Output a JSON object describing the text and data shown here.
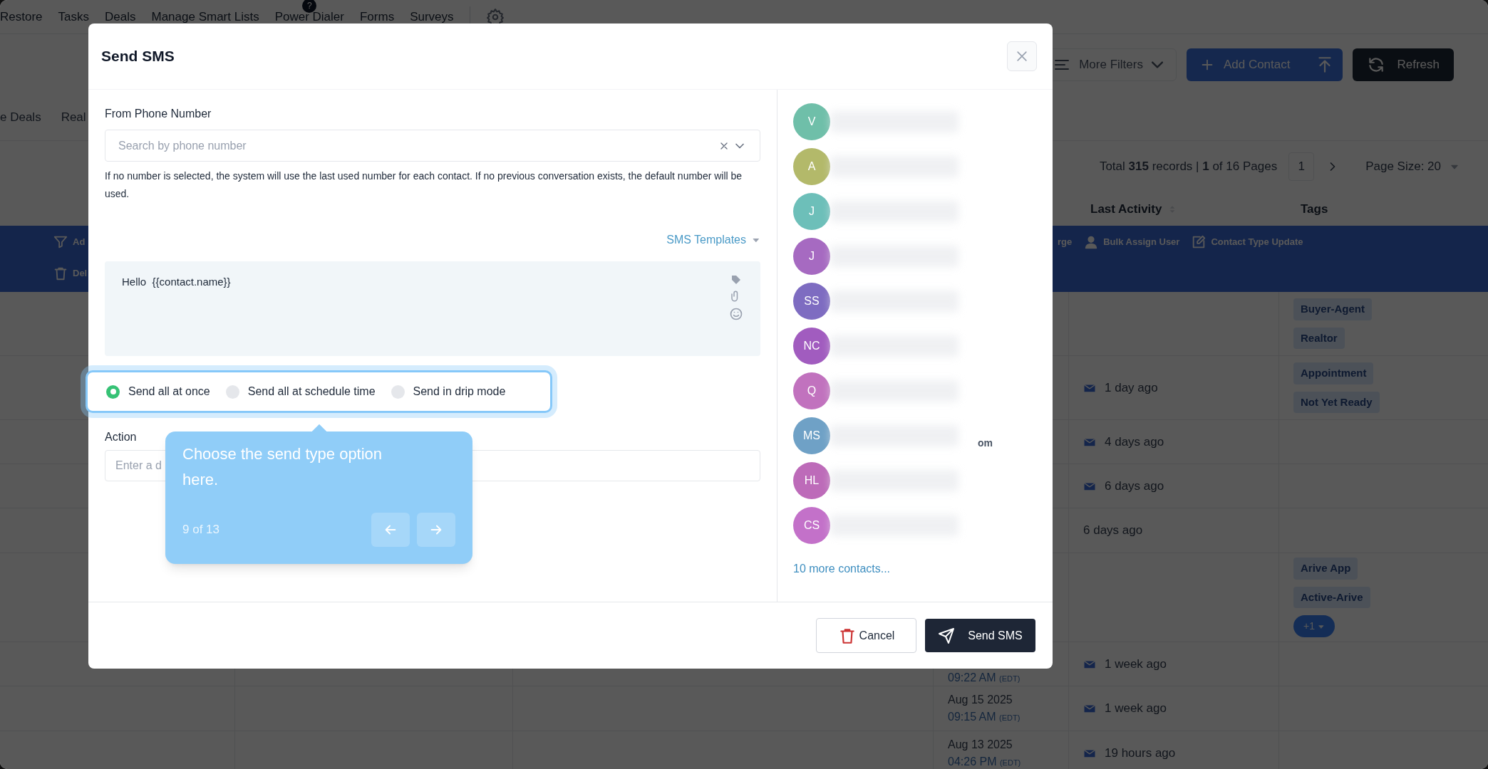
{
  "nav": {
    "items": [
      {
        "label": "Restore"
      },
      {
        "label": "Tasks"
      },
      {
        "label": "Deals"
      },
      {
        "label": "Manage Smart Lists"
      },
      {
        "label": "Power Dialer",
        "badge": "?"
      },
      {
        "label": "Forms"
      },
      {
        "label": "Surveys"
      }
    ]
  },
  "toolbar": {
    "more_filters": "More Filters",
    "add_contact": "Add Contact",
    "refresh": "Refresh"
  },
  "view_tabs": [
    "e Deals",
    "Real"
  ],
  "pagination": {
    "summary": "Total **315** records | **1** of 16 Pages",
    "page": "1",
    "page_size": "Page Size: 20"
  },
  "table": {
    "columns": [
      {
        "label": "Last Activity",
        "sortable": true
      },
      {
        "label": "Tags",
        "sortable": false
      }
    ],
    "bulk_actions_left": [
      {
        "kind": "filter",
        "label": "Ad"
      },
      {
        "kind": "trash",
        "label": "Del"
      }
    ],
    "bulk_actions_right": [
      {
        "kind": "none",
        "label": "rge"
      },
      {
        "kind": "user",
        "label": "Bulk Assign User"
      },
      {
        "kind": "edit",
        "label": "Contact Type Update"
      }
    ],
    "rows": [
      {
        "mail": false,
        "tags": [
          "Buyer-Agent",
          "Realtor"
        ]
      },
      {
        "activity": "1 day ago",
        "mail": true,
        "tags": [
          "Appointment",
          "Not Yet Ready"
        ]
      },
      {
        "activity": "4 days ago",
        "mail": true
      },
      {
        "activity": "6 days ago",
        "mail": true
      },
      {
        "activity": "6 days ago",
        "mail": false
      },
      {
        "mail": false,
        "tags": [
          "Arive App",
          "Active-Arive"
        ],
        "more": "+1"
      },
      {
        "time": "09:22 AM",
        "tz": "(EDT)",
        "activity": "1 week ago",
        "mail": true
      },
      {
        "date": "Aug 15 2025",
        "time": "09:15 AM",
        "tz": "(EDT)",
        "activity": "1 week ago",
        "mail": true
      },
      {
        "date": "Aug 13 2025",
        "time": "04:26 PM",
        "tz": "(EDT)",
        "activity": "19 hours ago",
        "mail": true
      }
    ]
  },
  "modal": {
    "title": "Send SMS",
    "from_label": "From Phone Number",
    "from_placeholder": "Search by phone number",
    "help": "If no number is selected, the system will use the last used number for each contact. If no previous conversation exists, the default number will be used.",
    "templates": "SMS Templates",
    "message": "Hello  {{contact.name}}",
    "send_modes": [
      {
        "label": "Send all at once",
        "selected": true
      },
      {
        "label": "Send all at schedule time",
        "selected": false
      },
      {
        "label": "Send in drip mode",
        "selected": false
      }
    ],
    "action_label": "Action",
    "action_placeholder": "Enter a d",
    "contacts": [
      {
        "initials": "V",
        "color": "#6fbfa9"
      },
      {
        "initials": "A",
        "color": "#b3b96a"
      },
      {
        "initials": "J",
        "color": "#6dbfb9"
      },
      {
        "initials": "J",
        "color": "#a66ac1"
      },
      {
        "initials": "SS",
        "color": "#7e6cc1"
      },
      {
        "initials": "NC",
        "color": "#a15cbf"
      },
      {
        "initials": "Q",
        "color": "#c172be"
      },
      {
        "initials": "MS",
        "color": "#6fa1c6",
        "visible": "om"
      },
      {
        "initials": "HL",
        "color": "#bd6bb9"
      },
      {
        "initials": "CS",
        "color": "#c371c9"
      }
    ],
    "more_contacts": "10 more contacts...",
    "cancel": "Cancel",
    "send": "Send SMS"
  },
  "tour": {
    "text": "Choose the send type option here.",
    "step": "9 of 13"
  }
}
